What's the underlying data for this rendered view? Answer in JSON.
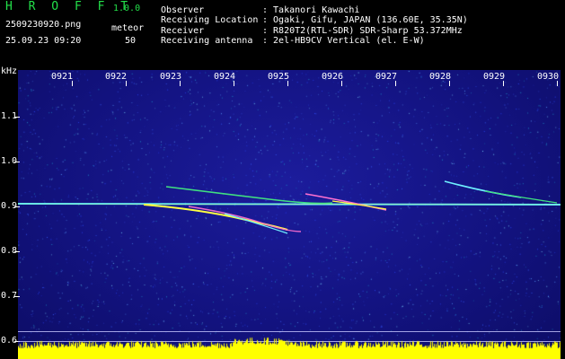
{
  "app": {
    "logo": "H R O F F T",
    "version": "1.0.0"
  },
  "file": {
    "filename": "2509230920.png",
    "datetime": "25.09.23 09:20",
    "meteor_label": "meteor",
    "meteor_count": "50"
  },
  "info": {
    "observer_label": "Observer",
    "observer_value": ": Takanori Kawachi",
    "location_label": "Receiving Location",
    "location_value": ": Ogaki, Gifu, JAPAN (136.60E, 35.35N)",
    "receiver_label": "Receiver",
    "receiver_value": ": R820T2(RTL-SDR) SDR-Sharp 53.372MHz",
    "antenna_label": "Receiving antenna",
    "antenna_value": ": 2el-HB9CV Vertical (el. E-W)"
  },
  "axes": {
    "y_unit": "kHz",
    "y_ticks": [
      "1.1",
      "1.0",
      "0.9",
      "0.8",
      "0.7",
      "0.6"
    ],
    "x_ticks": [
      "0921",
      "0922",
      "0923",
      "0924",
      "0925",
      "0926",
      "0927",
      "0928",
      "0929",
      "0930"
    ]
  },
  "colors": {
    "accent": "#23e04a",
    "bg": "#000000",
    "spectrum": "#14147f",
    "signal": "#ffff00"
  }
}
